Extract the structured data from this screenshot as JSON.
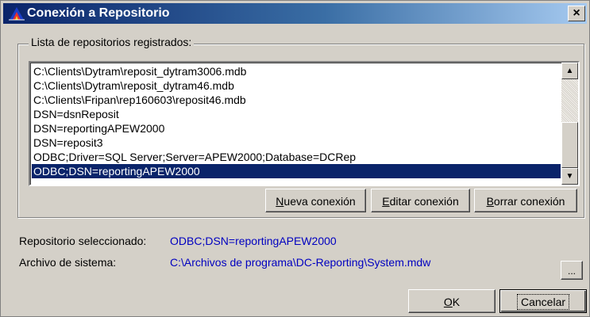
{
  "window": {
    "title": "Conexión a Repositorio",
    "close_label": "×"
  },
  "group": {
    "label": "Lista de repositorios registrados:"
  },
  "repositories": [
    "C:\\Clients\\Dytram\\reposit_dytram3006.mdb",
    "C:\\Clients\\Dytram\\reposit_dytram46.mdb",
    "C:\\Clients\\Fripan\\rep160603\\reposit46.mdb",
    "DSN=dsnReposit",
    "DSN=reportingAPEW2000",
    "DSN=reposit3",
    "ODBC;Driver=SQL Server;Server=APEW2000;Database=DCRep",
    "ODBC;DSN=reportingAPEW2000"
  ],
  "selected_index": 7,
  "scrollbar": {
    "up": "▲",
    "down": "▼"
  },
  "buttons": {
    "nueva": {
      "mnemonic": "N",
      "rest": "ueva conexión"
    },
    "editar": {
      "mnemonic": "E",
      "rest": "ditar conexión"
    },
    "borrar": {
      "mnemonic": "B",
      "rest": "orrar conexión"
    },
    "ok": {
      "mnemonic": "O",
      "rest": "K"
    },
    "cancel": "Cancelar",
    "browse": "..."
  },
  "info": {
    "selected_label": "Repositorio seleccionado:",
    "selected_value": "ODBC;DSN=reportingAPEW2000",
    "system_label": "Archivo de sistema:",
    "system_value": "C:\\Archivos de programa\\DC-Reporting\\System.mdw"
  },
  "colors": {
    "accent": "#0a246a",
    "value_text": "#0000c0",
    "face": "#d4d0c8"
  }
}
